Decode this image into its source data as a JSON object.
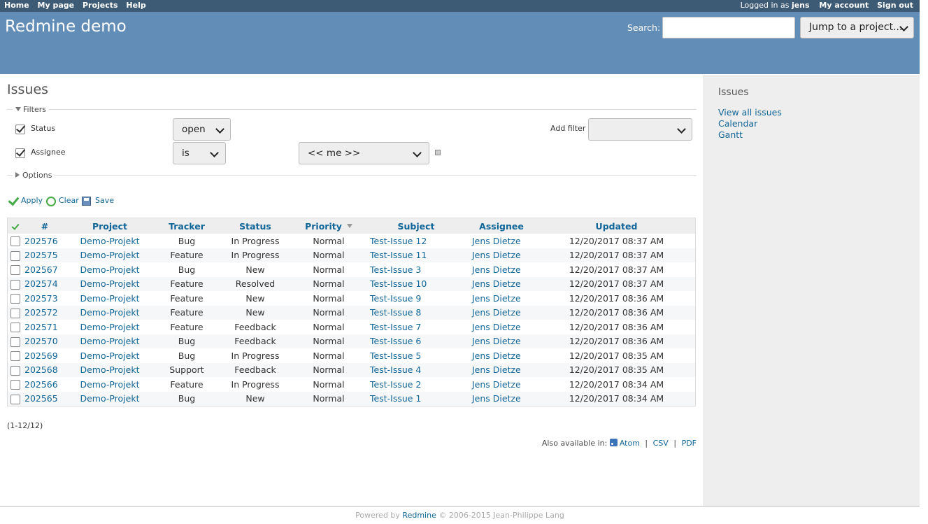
{
  "top_menu": {
    "left": [
      "Home",
      "My page",
      "Projects",
      "Help"
    ],
    "logged_in_prefix": "Logged in as",
    "user": "jens",
    "my_account": "My account",
    "sign_out": "Sign out"
  },
  "header": {
    "title": "Redmine demo",
    "search_label": "Search:",
    "jump_label": "Jump to a project..."
  },
  "page": {
    "title": "Issues"
  },
  "filters": {
    "legend": "Filters",
    "status": {
      "label": "Status",
      "operator": "open"
    },
    "assignee": {
      "label": "Assignee",
      "operator": "is",
      "value": "<< me >>"
    },
    "add_filter_label": "Add filter",
    "add_filter_value": ""
  },
  "options": {
    "legend": "Options"
  },
  "actions": {
    "apply": "Apply",
    "clear": "Clear",
    "save": "Save"
  },
  "table": {
    "headers": {
      "id": "#",
      "project": "Project",
      "tracker": "Tracker",
      "status": "Status",
      "priority": "Priority",
      "subject": "Subject",
      "assignee": "Assignee",
      "updated": "Updated"
    },
    "rows": [
      {
        "id": "202576",
        "project": "Demo-Projekt",
        "tracker": "Bug",
        "status": "In Progress",
        "priority": "Normal",
        "subject": "Test-Issue 12",
        "assignee": "Jens Dietze",
        "updated": "12/20/2017 08:37 AM"
      },
      {
        "id": "202575",
        "project": "Demo-Projekt",
        "tracker": "Feature",
        "status": "In Progress",
        "priority": "Normal",
        "subject": "Test-Issue 11",
        "assignee": "Jens Dietze",
        "updated": "12/20/2017 08:37 AM"
      },
      {
        "id": "202567",
        "project": "Demo-Projekt",
        "tracker": "Bug",
        "status": "New",
        "priority": "Normal",
        "subject": "Test-Issue 3",
        "assignee": "Jens Dietze",
        "updated": "12/20/2017 08:37 AM"
      },
      {
        "id": "202574",
        "project": "Demo-Projekt",
        "tracker": "Feature",
        "status": "Resolved",
        "priority": "Normal",
        "subject": "Test-Issue 10",
        "assignee": "Jens Dietze",
        "updated": "12/20/2017 08:37 AM"
      },
      {
        "id": "202573",
        "project": "Demo-Projekt",
        "tracker": "Feature",
        "status": "New",
        "priority": "Normal",
        "subject": "Test-Issue 9",
        "assignee": "Jens Dietze",
        "updated": "12/20/2017 08:36 AM"
      },
      {
        "id": "202572",
        "project": "Demo-Projekt",
        "tracker": "Feature",
        "status": "New",
        "priority": "Normal",
        "subject": "Test-Issue 8",
        "assignee": "Jens Dietze",
        "updated": "12/20/2017 08:36 AM"
      },
      {
        "id": "202571",
        "project": "Demo-Projekt",
        "tracker": "Feature",
        "status": "Feedback",
        "priority": "Normal",
        "subject": "Test-Issue 7",
        "assignee": "Jens Dietze",
        "updated": "12/20/2017 08:36 AM"
      },
      {
        "id": "202570",
        "project": "Demo-Projekt",
        "tracker": "Bug",
        "status": "Feedback",
        "priority": "Normal",
        "subject": "Test-Issue 6",
        "assignee": "Jens Dietze",
        "updated": "12/20/2017 08:36 AM"
      },
      {
        "id": "202569",
        "project": "Demo-Projekt",
        "tracker": "Bug",
        "status": "In Progress",
        "priority": "Normal",
        "subject": "Test-Issue 5",
        "assignee": "Jens Dietze",
        "updated": "12/20/2017 08:35 AM"
      },
      {
        "id": "202568",
        "project": "Demo-Projekt",
        "tracker": "Support",
        "status": "Feedback",
        "priority": "Normal",
        "subject": "Test-Issue 4",
        "assignee": "Jens Dietze",
        "updated": "12/20/2017 08:35 AM"
      },
      {
        "id": "202566",
        "project": "Demo-Projekt",
        "tracker": "Feature",
        "status": "In Progress",
        "priority": "Normal",
        "subject": "Test-Issue 2",
        "assignee": "Jens Dietze",
        "updated": "12/20/2017 08:34 AM"
      },
      {
        "id": "202565",
        "project": "Demo-Projekt",
        "tracker": "Bug",
        "status": "New",
        "priority": "Normal",
        "subject": "Test-Issue 1",
        "assignee": "Jens Dietze",
        "updated": "12/20/2017 08:34 AM"
      }
    ]
  },
  "pagination": "(1-12/12)",
  "other_formats": {
    "label": "Also available in:",
    "atom": "Atom",
    "csv": "CSV",
    "pdf": "PDF",
    "separator": "|"
  },
  "sidebar": {
    "title": "Issues",
    "links": [
      "View all issues",
      "Calendar",
      "Gantt"
    ]
  },
  "footer": {
    "powered_by": "Powered by",
    "redmine": "Redmine",
    "copyright": "© 2006-2015 Jean-Philippe Lang"
  },
  "colors": {
    "top_menu": "#3e5b76",
    "header": "#628db6",
    "link": "#169"
  }
}
